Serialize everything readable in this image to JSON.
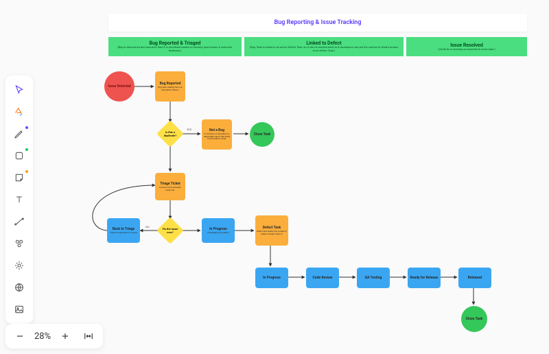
{
  "title": "Bug Reporting & Issue Tracking",
  "lanes": [
    {
      "title": "Bug Reported & Triaged",
      "desc": "(Bug is discovered and reported, then it is prioritized based on severity, past issues & customer feedback.)"
    },
    {
      "title": "Linked to Defect",
      "desc": "(Bug Task is linked to an active Defect Task, so it can be tracked back to & developers can get the context of what's broken from defect Task.)"
    },
    {
      "title": "Issue Resolved",
      "desc": "(Verify fix is working as expected & close task.)"
    }
  ],
  "nodes": {
    "issue_detected": {
      "title": "Issue Detected"
    },
    "bug_reported": {
      "title": "Bug Reported",
      "sub": "Bug Task created, then a & description filled in"
    },
    "d1": {
      "title": "Is this\\na duplicate?"
    },
    "not_a_bug": {
      "title": "Not a Bug",
      "sub": "If confusion or frustration is reasonable, report that entity to the product owner."
    },
    "close1": {
      "title": "Close Task"
    },
    "triage": {
      "title": "Triage Ticket",
      "sub": "Priority & SLA reviewed, owner set."
    },
    "d2": {
      "title": "Fix the\\nissue now?"
    },
    "back_triage": {
      "title": "Back to Triage",
      "sub": "Ticket moved back for re-eval"
    },
    "inprog1": {
      "title": "In Progress",
      "sub": "Investigating the defect"
    },
    "defect": {
      "title": "Defect Task",
      "sub": "Defect task linked, this context is visible in Defect Task UI."
    },
    "inprog2": {
      "title": "In Progress"
    },
    "code_review": {
      "title": "Code Review"
    },
    "qa": {
      "title": "QA Testing"
    },
    "ready": {
      "title": "Ready for Release"
    },
    "released": {
      "title": "Released"
    },
    "close2": {
      "title": "Close Task"
    }
  },
  "edge_labels": {
    "e_d1_nab": "YES",
    "e_d2_back": "NO"
  },
  "colors": {
    "red": "#ef5350",
    "orange": "#fbae3c",
    "yellow": "#fde047",
    "blue": "#3aa6f2",
    "green_node": "#34c759",
    "lane": "#4ade80",
    "title": "#5a3cff"
  },
  "zoom": {
    "level": "28%"
  },
  "tool_dots": {
    "pen": "#6b46ff",
    "shape": "#22c55e",
    "sticky": "#f59e0b"
  }
}
